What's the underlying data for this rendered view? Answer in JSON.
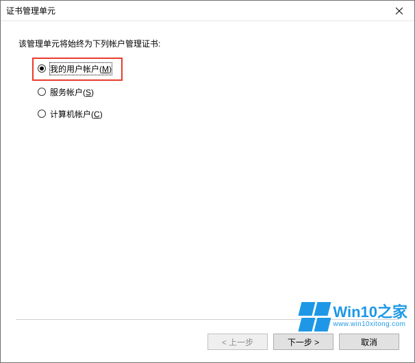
{
  "window": {
    "title": "证书管理单元"
  },
  "prompt": "该管理单元将始终为下列帐户管理证书:",
  "options": {
    "myUser": {
      "label": "我的用户帐户",
      "accel": "M",
      "checked": true
    },
    "service": {
      "label": "服务帐户",
      "accel": "S",
      "checked": false
    },
    "computer": {
      "label": "计算机帐户",
      "accel": "C",
      "checked": false
    }
  },
  "buttons": {
    "back": "< 上一步",
    "next": "下一步 >",
    "cancel": "取消"
  },
  "watermark": {
    "brand": "Win10",
    "suffix": "之家",
    "url": "www.win10xitong.com"
  }
}
